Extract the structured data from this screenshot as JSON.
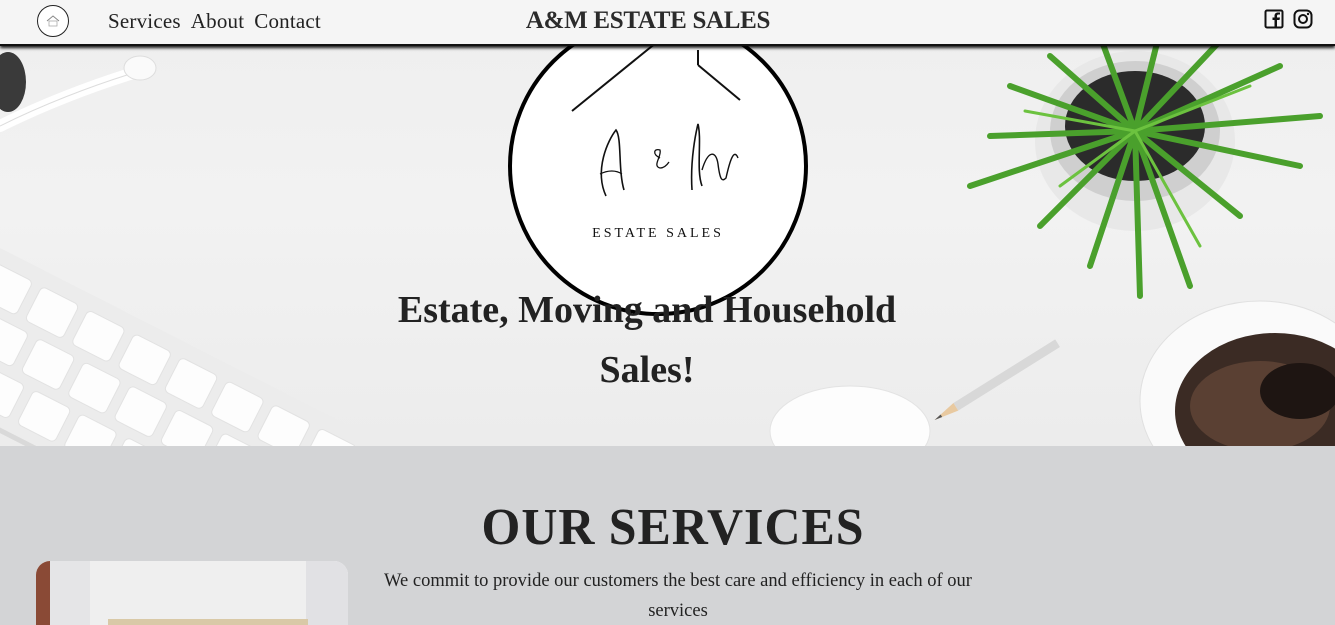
{
  "nav": {
    "logo_icon": "house-logo-icon",
    "links": [
      "Services",
      "About",
      "Contact"
    ],
    "brand": "A&M ESTATE SALES",
    "social": [
      "facebook-icon",
      "instagram-icon"
    ]
  },
  "hero": {
    "logo_script": "a & m",
    "logo_sub": "ESTATE SALES",
    "title": "Estate, Moving and Household Sales!"
  },
  "services": {
    "heading": "OUR SERVICES",
    "description": "We commit to provide our customers the best care and efficiency in each of our services"
  },
  "colors": {
    "nav_bg": "#f5f5f5",
    "section_bg": "#d3d4d6",
    "text": "#222222",
    "plant_green": "#4aa02c"
  }
}
